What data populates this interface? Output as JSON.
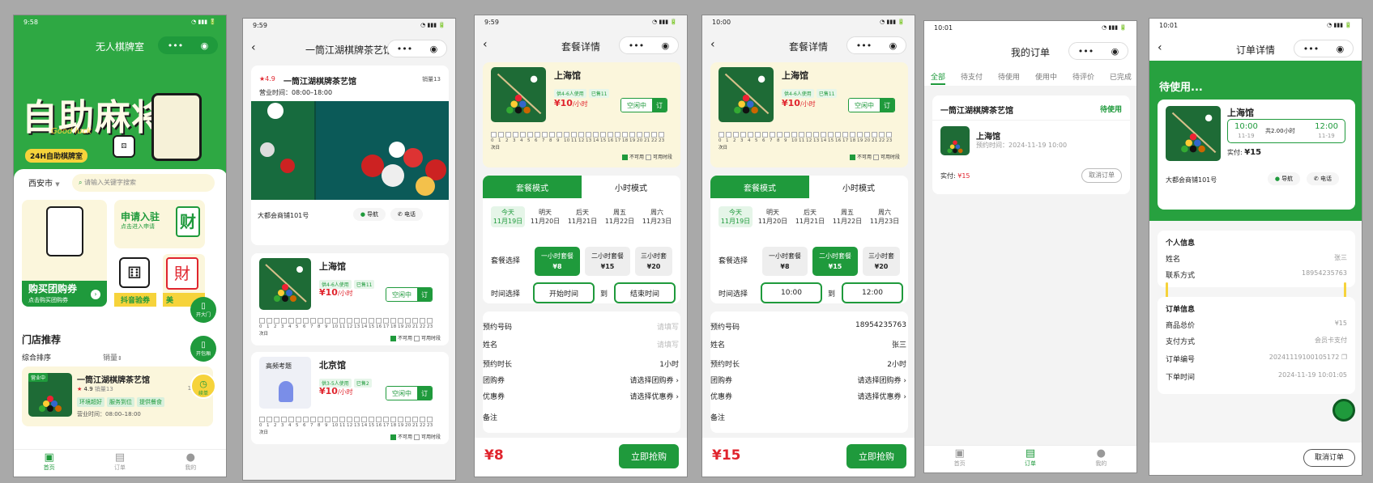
{
  "colors": {
    "brand": "#1f9a3c",
    "price": "#e0242d",
    "yellow": "#f6d33b"
  },
  "p1": {
    "status_time": "9:58",
    "title": "无人棋牌室",
    "banner_big": "自助麻将",
    "banner_sub": "24H自助棋牌室",
    "banner_script": "Good luck",
    "city": "西安市",
    "search_placeholder": "请输入关键字搜索",
    "promo_buy": "购买团购券",
    "promo_buy_sub": "点击购买团购券",
    "promo_join": "申请入驻",
    "promo_join_sub": "点击进入申请",
    "promo_join_tile": "财",
    "promo_douyin": "抖音验券",
    "promo_meituan": "美",
    "open_door": "开大门",
    "open_room": "开包厢",
    "renew": "续单",
    "section_title": "门店推荐",
    "sort1": "综合排序",
    "sort2": "销量",
    "store": {
      "badge": "营业中",
      "name": "一筒江湖棋牌茶艺馆",
      "rating": "4.9",
      "sales": "销量13",
      "distance": "130",
      "tags": [
        "环境超好",
        "服务到位",
        "提供餐食"
      ],
      "hours": "营业时间：08:00–18:00"
    },
    "tabbar": [
      "首页",
      "订单",
      "我的"
    ]
  },
  "p2": {
    "status_time": "9:59",
    "title": "一筒江湖棋牌茶艺馆",
    "rating": "4.9",
    "name": "一筒江湖棋牌茶艺馆",
    "sales": "销量13",
    "hours": "营业时间：08:00–18:00",
    "address": "大都会商铺101号",
    "nav": "导航",
    "phone": "电话",
    "rooms": [
      {
        "title_tag": "",
        "name": "上海馆",
        "tags": [
          "供4-6人使用",
          "已售11"
        ],
        "price": "¥10",
        "unit": "/小时",
        "status": "空闲中",
        "book": "订"
      },
      {
        "title_tag": "高频考题",
        "name": "北京馆",
        "tags": [
          "供3-5人使用",
          "已售2"
        ],
        "price": "¥10",
        "unit": "/小时",
        "status": "空闲中",
        "book": "订"
      }
    ],
    "legend_unavail": "不可用",
    "legend_avail": "可用时段",
    "next_day": "次日"
  },
  "p3": {
    "status_time": "9:59",
    "title": "套餐详情",
    "room": {
      "name": "上海馆",
      "tags": [
        "供4-6人使用",
        "已售11"
      ],
      "price": "¥10",
      "unit": "/小时",
      "status": "空闲中",
      "book": "订"
    },
    "legend_unavail": "不可用",
    "legend_avail": "可用时段",
    "next_day": "次日",
    "tab_pkg": "套餐模式",
    "tab_hour": "小时模式",
    "dates": [
      {
        "d": "今天",
        "m": "11月19日"
      },
      {
        "d": "明天",
        "m": "11月20日"
      },
      {
        "d": "后天",
        "m": "11月21日"
      },
      {
        "d": "周五",
        "m": "11月22日"
      },
      {
        "d": "周六",
        "m": "11月23日"
      }
    ],
    "pkg_label": "套餐选择",
    "pkgs": [
      {
        "n": "一小时套餐",
        "p": "¥8"
      },
      {
        "n": "二小时套餐",
        "p": "¥15"
      },
      {
        "n": "三小时套",
        "p": "¥20"
      }
    ],
    "time_label": "时间选择",
    "start": "开始时间",
    "to": "到",
    "end": "结束时间",
    "form": [
      {
        "k": "预约号码",
        "v": "请填写"
      },
      {
        "k": "姓名",
        "v": "请填写"
      },
      {
        "k": "预约时长",
        "v": "1小时"
      },
      {
        "k": "团购券",
        "v": "请选择团购券 ›"
      },
      {
        "k": "优惠券",
        "v": "请选择优惠券 ›"
      },
      {
        "k": "备注",
        "v": ""
      }
    ],
    "total": "¥8",
    "buy": "立即抢购"
  },
  "p4": {
    "status_time": "10:00",
    "title": "套餐详情",
    "start": "10:00",
    "end": "12:00",
    "form": [
      {
        "k": "预约号码",
        "v": "18954235763"
      },
      {
        "k": "姓名",
        "v": "张三"
      },
      {
        "k": "预约时长",
        "v": "2小时"
      },
      {
        "k": "团购券",
        "v": "请选择团购券 ›"
      },
      {
        "k": "优惠券",
        "v": "请选择优惠券 ›"
      },
      {
        "k": "备注",
        "v": ""
      }
    ],
    "total": "¥15",
    "buy": "立即抢购"
  },
  "p5": {
    "status_time": "10:01",
    "title": "我的订单",
    "tabs": [
      "全部",
      "待支付",
      "待使用",
      "使用中",
      "待评价",
      "已完成"
    ],
    "order": {
      "store": "一筒江湖棋牌茶艺馆",
      "status": "待使用",
      "room": "上海馆",
      "time": "预约时间：2024-11-19 10:00",
      "paid_label": "实付:",
      "paid": "¥15",
      "cancel": "取消订单"
    },
    "tabbar": [
      "首页",
      "订单",
      "我的"
    ]
  },
  "p6": {
    "status_time": "10:01",
    "title": "订单详情",
    "state": "待使用...",
    "room": "上海馆",
    "start": "10:00",
    "start_d": "11-19",
    "dur": "共2.00小时",
    "end": "12:00",
    "end_d": "11-19",
    "paid_label": "实付:",
    "paid": "¥15",
    "address": "大都会商铺101号",
    "nav": "导航",
    "phone": "电话",
    "personal_title": "个人信息",
    "name_k": "姓名",
    "name_v": "张三",
    "contact_k": "联系方式",
    "contact_v": "18954235763",
    "order_title": "订单信息",
    "info": [
      {
        "k": "商品总价",
        "v": "¥15"
      },
      {
        "k": "支付方式",
        "v": "会员卡支付"
      },
      {
        "k": "订单编号",
        "v": "20241119100105172"
      },
      {
        "k": "下单时间",
        "v": "2024-11-19 10:01:05"
      }
    ],
    "cancel": "取消订单"
  }
}
